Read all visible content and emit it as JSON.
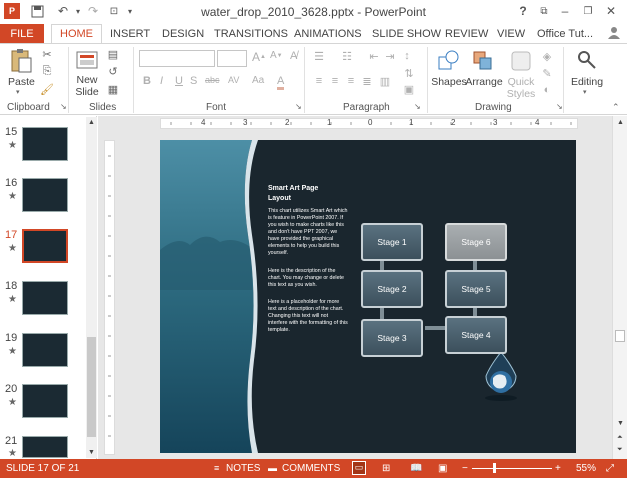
{
  "window": {
    "title": "water_drop_2010_3628.pptx - PowerPoint",
    "help": "?"
  },
  "tabs": [
    "FILE",
    "HOME",
    "INSERT",
    "DESIGN",
    "TRANSITIONS",
    "ANIMATIONS",
    "SLIDE SHOW",
    "REVIEW",
    "VIEW"
  ],
  "account": "Office Tut...",
  "ribbon": {
    "paste": "Paste",
    "new_slide_1": "New",
    "new_slide_2": "Slide",
    "shapes": "Shapes",
    "arrange": "Arrange",
    "quick_styles_1": "Quick",
    "quick_styles_2": "Styles",
    "editing": "Editing",
    "groups": {
      "clipboard": "Clipboard",
      "slides": "Slides",
      "font": "Font",
      "paragraph": "Paragraph",
      "drawing": "Drawing"
    },
    "font_buttons": [
      "B",
      "I",
      "U",
      "S",
      "abc",
      "AV",
      "Aa",
      "A"
    ]
  },
  "ruler_numbers": [
    "4",
    "3",
    "2",
    "1",
    "0",
    "1",
    "2",
    "3",
    "4"
  ],
  "thumbnails": [
    {
      "num": "15",
      "star": "★"
    },
    {
      "num": "16",
      "star": "★"
    },
    {
      "num": "17",
      "star": "★"
    },
    {
      "num": "18",
      "star": "★"
    },
    {
      "num": "19",
      "star": "★"
    },
    {
      "num": "20",
      "star": "★"
    },
    {
      "num": "21",
      "star": "★"
    }
  ],
  "slide": {
    "heading": "Smart Art Page Layout",
    "para1": "This chart utilizes Smart Art which is feature in PowerPoint 2007. If you wish to make charts like this and don't have PPT 2007, we have provided the graphical elements to help you build this yourself.",
    "para2": "Here is the description of the chart. You may change or delete this text as you wish.",
    "para3": "Here is a placeholder for more text and description of the chart. Changing this text will not interfere with the formatting of this template.",
    "stages": [
      "Stage 1",
      "Stage 2",
      "Stage 3",
      "Stage 4",
      "Stage 5",
      "Stage 6"
    ]
  },
  "status": {
    "slide_info": "SLIDE 17 OF 21",
    "notes": "NOTES",
    "comments": "COMMENTS",
    "zoom": "55%",
    "zoom_minus": "−",
    "zoom_plus": "+"
  },
  "colors": {
    "accent": "#d24726",
    "slide_bg": "#1a262e",
    "water": "#2c6a80"
  }
}
